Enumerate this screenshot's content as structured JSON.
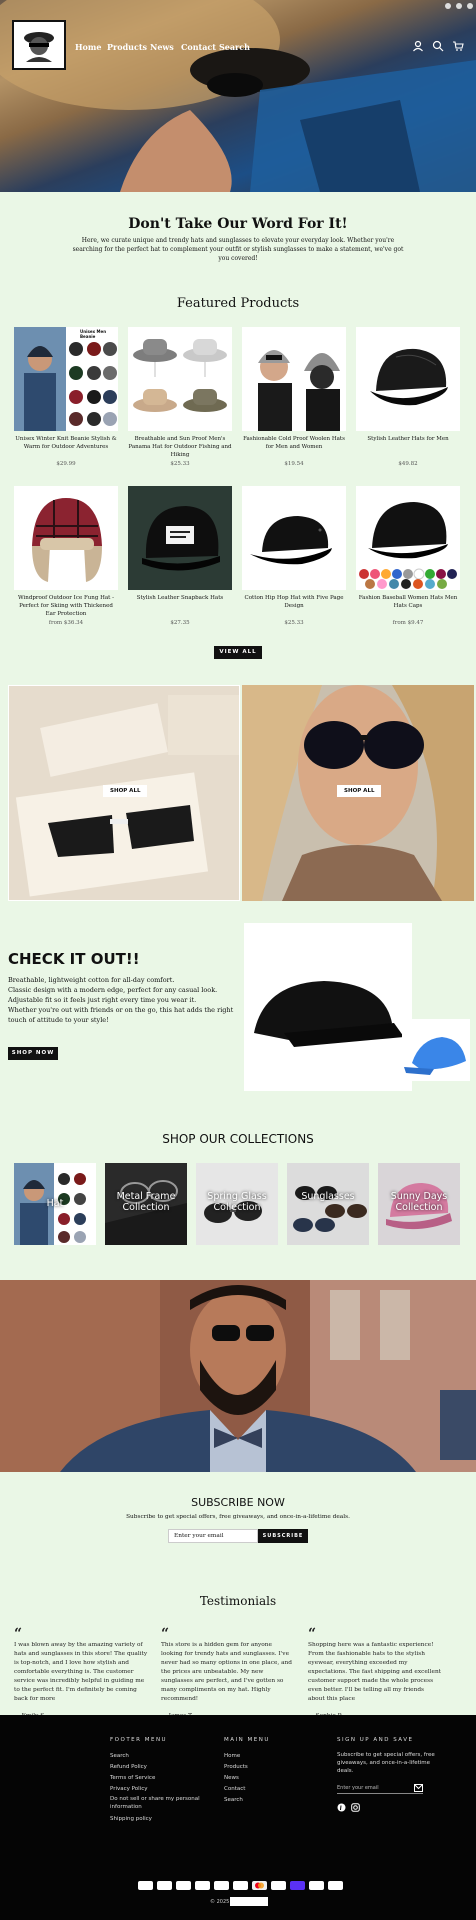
{
  "nav": {
    "items": [
      "Home",
      "Products",
      "News",
      "Contact",
      "Search"
    ]
  },
  "intro": {
    "title": "Don't Take Our Word For It!",
    "text": "Here, we curate unique and trendy hats and sunglasses to elevate your everyday look. Whether you're searching for the perfect hat to complement your outfit or stylish sunglasses to make a statement, we've got you covered!"
  },
  "featured": {
    "title": "Featured Products",
    "badge": "Unisex Men Beanie",
    "products": [
      {
        "name": "Unisex Winter Knit Beanie Stylish & Warm for Outdoor Adventures",
        "price": "$29.99"
      },
      {
        "name": "Breathable and Sun Proof Men's Panama Hat for Outdoor Fishing and Hiking",
        "price": "$25.33"
      },
      {
        "name": "Fashionable Cold Proof Woolen Hats for Men and Women",
        "price": "$19.54"
      },
      {
        "name": "Stylish Leather Hats for Men",
        "price": "$49.82"
      },
      {
        "name": "Windproof Outdoor Ice Fung Hat - Perfect for Skiing with Thickened Ear Protection",
        "price": "from $36.34"
      },
      {
        "name": "Stylish Leather Snapback Hats",
        "price": "$27.35"
      },
      {
        "name": "Cotton Hip Hop Hat with Five Page Design",
        "price": "$25.33"
      },
      {
        "name": "Fashion Baseball Women Hats Men Hats Caps",
        "price": "from $9.47"
      }
    ],
    "button": "VIEW ALL"
  },
  "promos": {
    "left_button": "SHOP ALL",
    "right_button": "SHOP ALL"
  },
  "checkout": {
    "title": "CHECK IT OUT!!",
    "lines": [
      "Breathable, lightweight cotton for all-day comfort.",
      " Classic design with a modern edge, perfect for any casual look.",
      " Adjustable fit so it feels just right every time you wear it.",
      " Whether you're out with friends or on the go, this hat adds the right touch of attitude to your style!"
    ],
    "button": "SHOP NOW"
  },
  "collections": {
    "title": "SHOP OUR COLLECTIONS",
    "items": [
      "Hat",
      "Metal Frame Collection",
      "Spring Glass Collection",
      "Sunglasses",
      "Sunny Days Collection"
    ]
  },
  "subscribe": {
    "title": "SUBSCRIBE NOW",
    "text": "Subscribe to get special offers, free giveaways, and once-in-a-lifetime deals.",
    "placeholder": "Enter your email",
    "button": "SUBSCRIBE"
  },
  "testimonials": {
    "title": "Testimonials",
    "items": [
      {
        "text": "I was blown away by the amazing variety of hats and sunglasses in this store! The quality is top-notch, and I love how stylish and comfortable everything is. The customer service was incredibly helpful in guiding me to the perfect fit. I'm definitely be coming back for more",
        "by": "— Emily S."
      },
      {
        "text": "This store is a hidden gem for anyone looking for trendy hats and sunglasses. I've never had so many options in one place, and the prices are unbeatable. My new sunglasses are perfect, and I've gotten so many compliments on my hat. Highly recommend!",
        "by": "— James T."
      },
      {
        "text": "Shopping here was a fantastic experience! From the fashionable hats to the stylish eyewear, everything exceeded my expectations. The fast shipping and excellent customer support made the whole process even better. I'll be telling all my friends about this place",
        "by": "— Sophie P."
      }
    ]
  },
  "footer": {
    "col1_title": "FOOTER MENU",
    "col1_links": [
      "Search",
      "Refund Policy",
      "Terms of Service",
      "Privacy Policy",
      "Do not sell or share my personal information",
      "Shipping policy"
    ],
    "col2_title": "MAIN MENU",
    "col2_links": [
      "Home",
      "Products",
      "News",
      "Contact",
      "Search"
    ],
    "col3_title": "SIGN UP AND SAVE",
    "col3_text": "Subscribe to get special offers, free giveaways, and once-in-a-lifetime deals.",
    "email_placeholder": "Enter your email",
    "copyright": "© 2025"
  },
  "colors": {
    "background": "#eaf7e6",
    "footer": "#050505",
    "button": "#111111"
  }
}
